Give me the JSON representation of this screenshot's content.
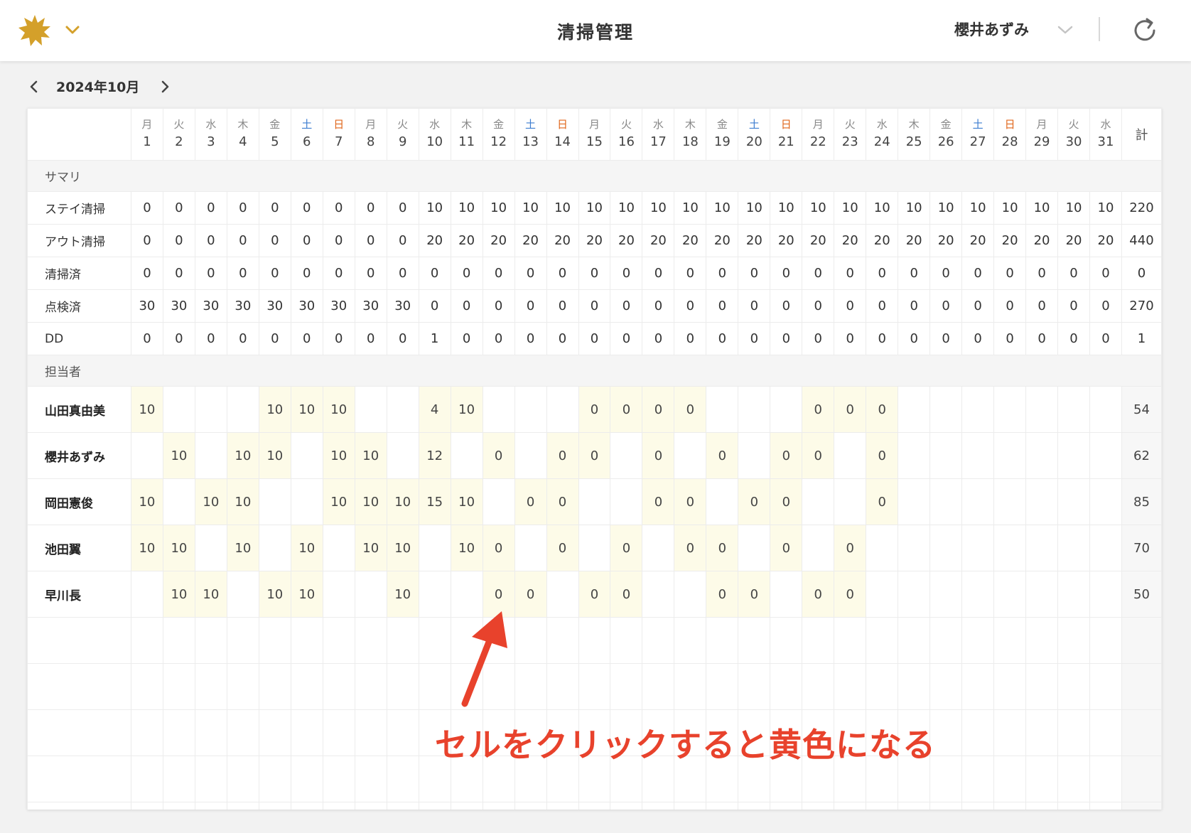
{
  "header": {
    "app_title": "清掃管理",
    "user_name": "櫻井あずみ",
    "logo_icon": "sun-badge-icon",
    "logo_color": "#d4a02a",
    "accent_color": "#d4a02a"
  },
  "month_nav": {
    "label": "2024年10月"
  },
  "calendar": {
    "days": [
      {
        "wd": "月",
        "d": "1",
        "type": "weekday"
      },
      {
        "wd": "火",
        "d": "2",
        "type": "weekday"
      },
      {
        "wd": "水",
        "d": "3",
        "type": "weekday"
      },
      {
        "wd": "木",
        "d": "4",
        "type": "weekday"
      },
      {
        "wd": "金",
        "d": "5",
        "type": "weekday"
      },
      {
        "wd": "土",
        "d": "6",
        "type": "sat"
      },
      {
        "wd": "日",
        "d": "7",
        "type": "sun"
      },
      {
        "wd": "月",
        "d": "8",
        "type": "weekday"
      },
      {
        "wd": "火",
        "d": "9",
        "type": "weekday"
      },
      {
        "wd": "水",
        "d": "10",
        "type": "weekday"
      },
      {
        "wd": "木",
        "d": "11",
        "type": "weekday"
      },
      {
        "wd": "金",
        "d": "12",
        "type": "weekday"
      },
      {
        "wd": "土",
        "d": "13",
        "type": "sat"
      },
      {
        "wd": "日",
        "d": "14",
        "type": "sun"
      },
      {
        "wd": "月",
        "d": "15",
        "type": "weekday"
      },
      {
        "wd": "火",
        "d": "16",
        "type": "weekday"
      },
      {
        "wd": "水",
        "d": "17",
        "type": "weekday"
      },
      {
        "wd": "木",
        "d": "18",
        "type": "weekday"
      },
      {
        "wd": "金",
        "d": "19",
        "type": "weekday"
      },
      {
        "wd": "土",
        "d": "20",
        "type": "sat"
      },
      {
        "wd": "日",
        "d": "21",
        "type": "sun"
      },
      {
        "wd": "月",
        "d": "22",
        "type": "weekday"
      },
      {
        "wd": "火",
        "d": "23",
        "type": "weekday"
      },
      {
        "wd": "水",
        "d": "24",
        "type": "weekday"
      },
      {
        "wd": "木",
        "d": "25",
        "type": "weekday"
      },
      {
        "wd": "金",
        "d": "26",
        "type": "weekday"
      },
      {
        "wd": "土",
        "d": "27",
        "type": "sat"
      },
      {
        "wd": "日",
        "d": "28",
        "type": "sun"
      },
      {
        "wd": "月",
        "d": "29",
        "type": "weekday"
      },
      {
        "wd": "火",
        "d": "30",
        "type": "weekday"
      },
      {
        "wd": "水",
        "d": "31",
        "type": "weekday"
      }
    ],
    "total_label": "計",
    "summary_section_label": "サマリ",
    "staff_section_label": "担当者",
    "summary_rows": [
      {
        "label": "ステイ清掃",
        "cls": "stay",
        "values": [
          "0",
          "0",
          "0",
          "0",
          "0",
          "0",
          "0",
          "0",
          "0",
          "10",
          "10",
          "10",
          "10",
          "10",
          "10",
          "10",
          "10",
          "10",
          "10",
          "10",
          "10",
          "10",
          "10",
          "10",
          "10",
          "10",
          "10",
          "10",
          "10",
          "10",
          "10"
        ],
        "total": "220"
      },
      {
        "label": "アウト清掃",
        "cls": "out",
        "values": [
          "0",
          "0",
          "0",
          "0",
          "0",
          "0",
          "0",
          "0",
          "0",
          "20",
          "20",
          "20",
          "20",
          "20",
          "20",
          "20",
          "20",
          "20",
          "20",
          "20",
          "20",
          "20",
          "20",
          "20",
          "20",
          "20",
          "20",
          "20",
          "20",
          "20",
          "20"
        ],
        "total": "440"
      },
      {
        "label": "清掃済",
        "cls": "done",
        "values": [
          "0",
          "0",
          "0",
          "0",
          "0",
          "0",
          "0",
          "0",
          "0",
          "0",
          "0",
          "0",
          "0",
          "0",
          "0",
          "0",
          "0",
          "0",
          "0",
          "0",
          "0",
          "0",
          "0",
          "0",
          "0",
          "0",
          "0",
          "0",
          "0",
          "0",
          "0"
        ],
        "total": "0"
      },
      {
        "label": "点検済",
        "cls": "inspect",
        "values": [
          "30",
          "30",
          "30",
          "30",
          "30",
          "30",
          "30",
          "30",
          "30",
          "0",
          "0",
          "0",
          "0",
          "0",
          "0",
          "0",
          "0",
          "0",
          "0",
          "0",
          "0",
          "0",
          "0",
          "0",
          "0",
          "0",
          "0",
          "0",
          "0",
          "0",
          "0"
        ],
        "total": "270"
      },
      {
        "label": "DD",
        "cls": "dd",
        "values": [
          "0",
          "0",
          "0",
          "0",
          "0",
          "0",
          "0",
          "0",
          "0",
          "1",
          "0",
          "0",
          "0",
          "0",
          "0",
          "0",
          "0",
          "0",
          "0",
          "0",
          "0",
          "0",
          "0",
          "0",
          "0",
          "0",
          "0",
          "0",
          "0",
          "0",
          "0"
        ],
        "total": "1"
      }
    ],
    "staff_rows": [
      {
        "name": "山田真由美",
        "cells": [
          "10",
          "",
          "",
          "",
          "10",
          "10",
          "10",
          "",
          "",
          "4",
          "10",
          "",
          "",
          "",
          "0",
          "0",
          "0",
          "0",
          "",
          "",
          "",
          "0",
          "0",
          "0",
          "",
          "",
          "",
          "",
          "",
          "",
          ""
        ],
        "total": "54"
      },
      {
        "name": "櫻井あずみ",
        "cells": [
          "",
          "10",
          "",
          "10",
          "10",
          "",
          "10",
          "10",
          "",
          "12",
          "",
          "0",
          "",
          "0",
          "0",
          "",
          "0",
          "",
          "0",
          "",
          "0",
          "0",
          "",
          "0",
          "",
          "",
          "",
          "",
          "",
          "",
          ""
        ],
        "total": "62"
      },
      {
        "name": "岡田憲俊",
        "cells": [
          "10",
          "",
          "10",
          "10",
          "",
          "",
          "10",
          "10",
          "10",
          "15",
          "10",
          "",
          "0",
          "0",
          "",
          "",
          "0",
          "0",
          "",
          "0",
          "0",
          "",
          "",
          "0",
          "",
          "",
          "",
          "",
          "",
          "",
          ""
        ],
        "total": "85"
      },
      {
        "name": "池田翼",
        "cells": [
          "10",
          "10",
          "",
          "10",
          "",
          "10",
          "",
          "10",
          "10",
          "",
          "10",
          "0",
          "",
          "0",
          "",
          "0",
          "",
          "0",
          "0",
          "",
          "0",
          "",
          "0",
          "",
          "",
          "",
          "",
          "",
          "",
          "",
          ""
        ],
        "total": "70"
      },
      {
        "name": "早川長",
        "cells": [
          "",
          "10",
          "10",
          "",
          "10",
          "10",
          "",
          "",
          "10",
          "",
          "",
          "0",
          "0",
          "",
          "0",
          "0",
          "",
          "",
          "0",
          "0",
          "",
          "0",
          "0",
          "",
          "",
          "",
          "",
          "",
          "",
          "",
          ""
        ],
        "total": "50"
      }
    ],
    "empty_rows": 5,
    "colors": {
      "highlight": "#fdfbe8",
      "saturday": "#3d7dd0",
      "sunday": "#e0661b",
      "stay": "#e0661b",
      "out": "#e8a12d",
      "done": "#3d7dd0",
      "inspect": "#8cc23e"
    }
  },
  "annotation": {
    "text": "セルをクリックすると黄色になる",
    "color": "#e8422c"
  }
}
